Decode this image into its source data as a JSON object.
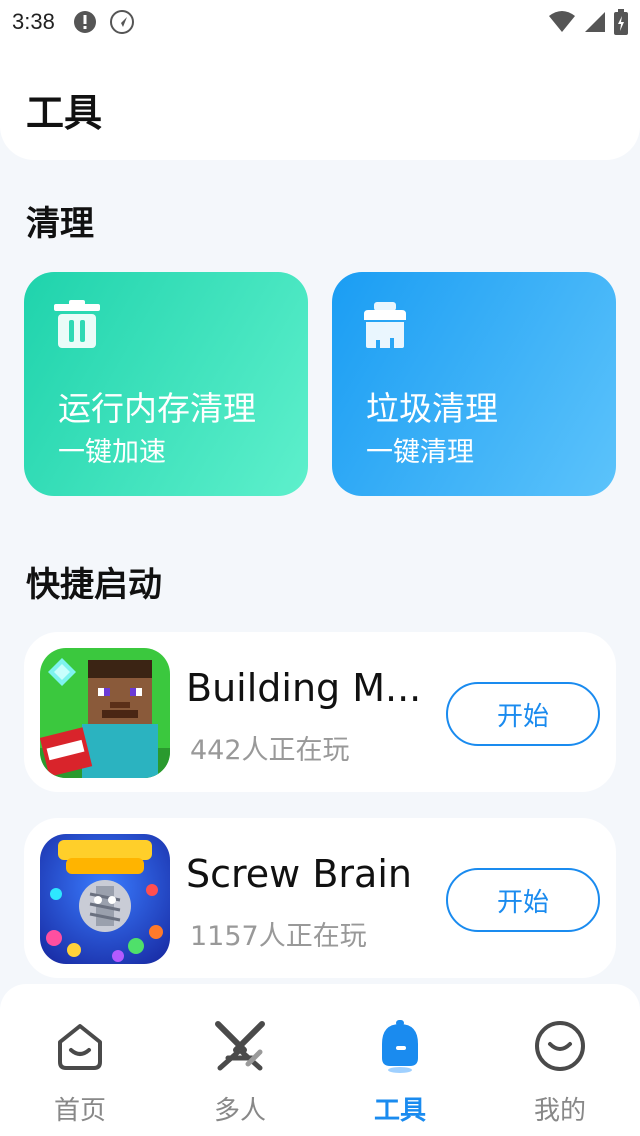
{
  "status_bar": {
    "time": "3:38"
  },
  "header": {
    "title": "工具"
  },
  "cleanup": {
    "section_title": "清理",
    "cards": [
      {
        "title": "运行内存清理",
        "subtitle": "一键加速",
        "icon": "trash-icon"
      },
      {
        "title": "垃圾清理",
        "subtitle": "一键清理",
        "icon": "broom-icon"
      }
    ]
  },
  "quick_launch": {
    "section_title": "快捷启动",
    "games": [
      {
        "name": "Building M...",
        "players": "442人正在玩",
        "button": "开始",
        "icon": "building-game-thumbnail"
      },
      {
        "name": "Screw Brain",
        "players": "1157人正在玩",
        "button": "开始",
        "icon": "screw-brain-thumbnail"
      }
    ]
  },
  "tabbar": {
    "tabs": [
      {
        "label": "首页",
        "icon": "home-icon",
        "active": false
      },
      {
        "label": "多人",
        "icon": "swords-icon",
        "active": false
      },
      {
        "label": "工具",
        "icon": "robot-icon",
        "active": true
      },
      {
        "label": "我的",
        "icon": "smile-icon",
        "active": false
      }
    ]
  },
  "colors": {
    "accent": "#1a8bef",
    "green_card": "#1fd3ac",
    "blue_card": "#1a9df3",
    "background": "#f4f7fb"
  }
}
